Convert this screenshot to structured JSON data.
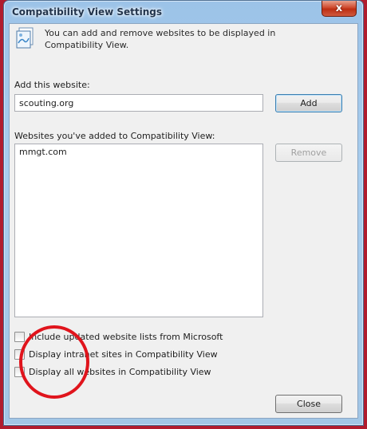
{
  "window": {
    "title": "Compatibility View Settings",
    "close_glyph": "x"
  },
  "info": {
    "icon": "web-pages-icon",
    "text": "You can add and remove websites to be displayed in Compatibility View."
  },
  "add_section": {
    "label": "Add this website:",
    "input_value": "scouting.org",
    "add_label": "Add"
  },
  "list_section": {
    "label": "Websites you've added to Compatibility View:",
    "items": [
      "mmgt.com"
    ],
    "remove_label": "Remove"
  },
  "options": [
    {
      "label": "Include updated website lists from Microsoft",
      "checked": false
    },
    {
      "label": "Display intranet sites in Compatibility View",
      "checked": false
    },
    {
      "label": "Display all websites in Compatibility View",
      "checked": false
    }
  ],
  "close_label": "Close",
  "colors": {
    "annotation_circle": "#e0141c",
    "title_bar": "#9cc3e8",
    "close_button": "#cf4a2e"
  }
}
